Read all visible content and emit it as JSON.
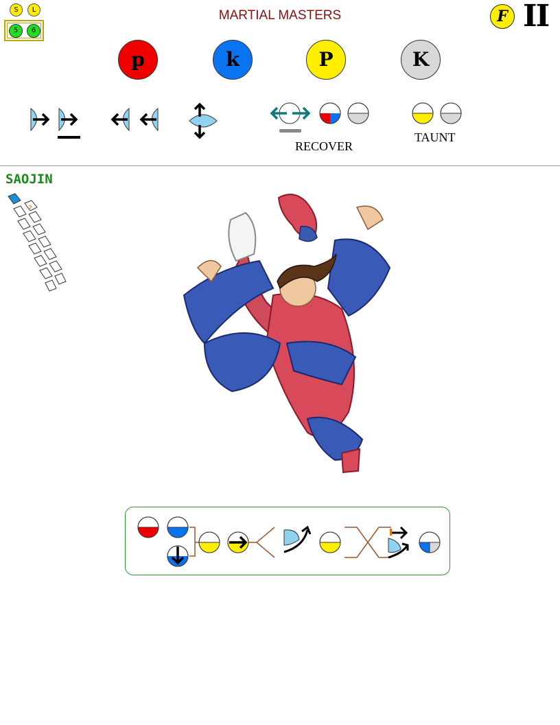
{
  "header": {
    "title": "MARTIAL MASTERS",
    "badge_s": "S",
    "badge_l": "L",
    "level_5": "5",
    "level_6": "6",
    "f_badge": "F",
    "game_numeral": "II"
  },
  "buttons": [
    {
      "key": "punch_light",
      "label": "p",
      "color": "#ee0000"
    },
    {
      "key": "kick_light",
      "label": "k",
      "color": "#0a74f0"
    },
    {
      "key": "punch_heavy",
      "label": "P",
      "color": "#ffee00"
    },
    {
      "key": "kick_heavy",
      "label": "K",
      "color": "#d8d8d8"
    }
  ],
  "controls": {
    "recover_label": "RECOVER",
    "taunt_label": "TAUNT",
    "icons": [
      "dash-forward-icon",
      "run-forward-icon",
      "backdash-icon",
      "jump-crouch-icon",
      "recover-arrows-icon",
      "taunt-buttons-icon"
    ]
  },
  "character": {
    "name": "SAOJIN",
    "question_mark": "?"
  },
  "colors": {
    "punch": "#ee0000",
    "kick": "#0a74f0",
    "heavy_punch": "#ffee00",
    "heavy_kick": "#d8d8d8",
    "title": "#8a1010",
    "name": "#1a8a1a",
    "icon_blue": "#8fd3f0",
    "teal": "#0f7a7a",
    "brown_line": "#a0522d"
  },
  "combo": {
    "steps": [
      "p-button-icon",
      "k-button-icon",
      "crouch-k-icon",
      "P-button-icon",
      "forward-P-icon",
      "launcher-icon",
      "P-button-icon",
      "cross-link-icon",
      "air-dash-icon",
      "k-K-button-icon"
    ]
  }
}
